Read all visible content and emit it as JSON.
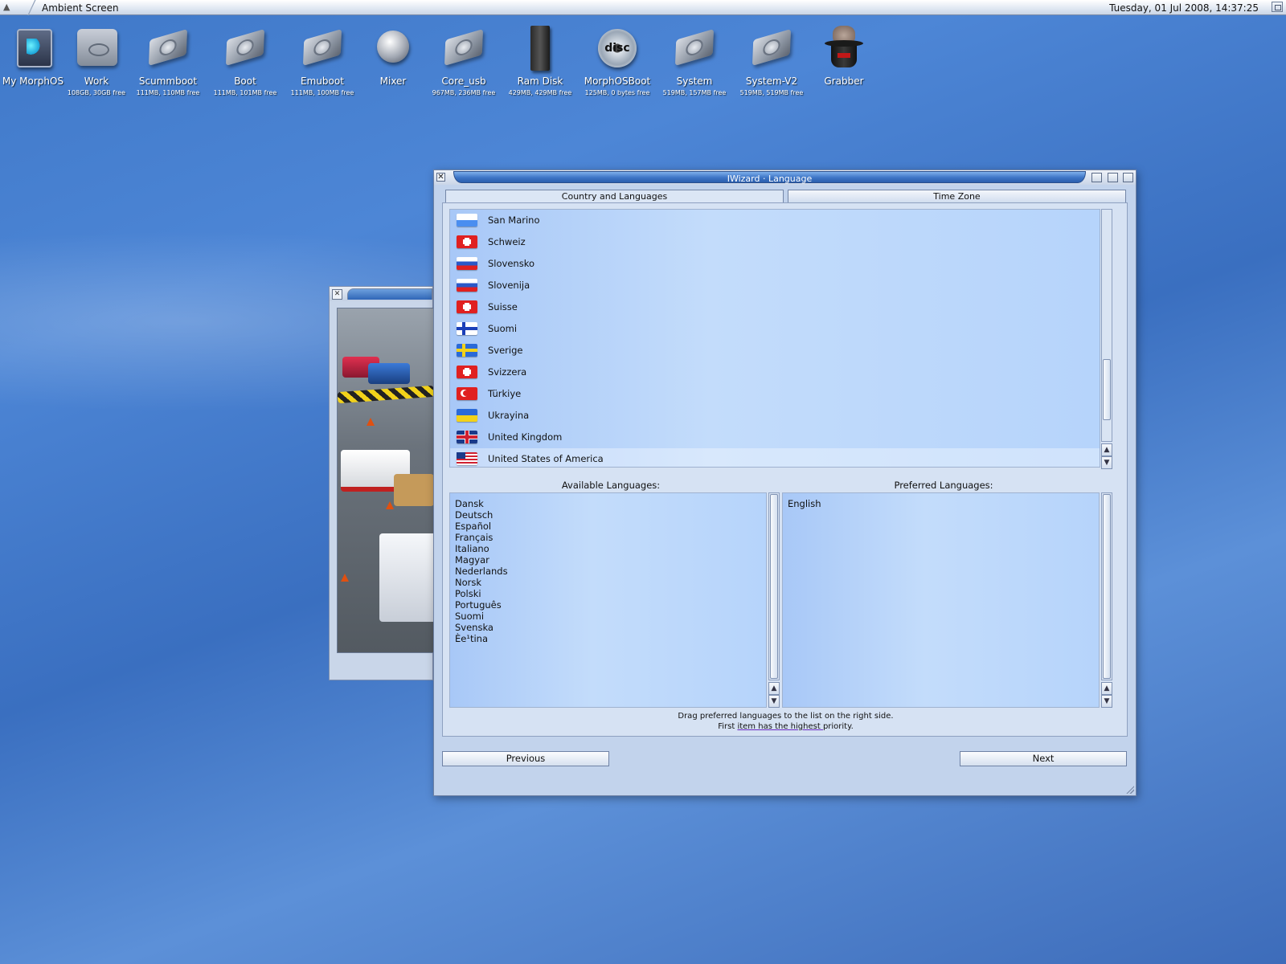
{
  "menubar": {
    "screen_title": "Ambient Screen",
    "clock": "Tuesday, 01 Jul 2008, 14:37:25"
  },
  "desktop_icons": [
    {
      "name": "My MorphOS",
      "info": "",
      "icon": "morphos-icon"
    },
    {
      "name": "Work",
      "info": "108GB, 30GB free",
      "icon": "harddisk-icon"
    },
    {
      "name": "Scummboot",
      "info": "111MB, 110MB free",
      "icon": "drive-icon"
    },
    {
      "name": "Boot",
      "info": "111MB, 101MB free",
      "icon": "drive-icon"
    },
    {
      "name": "Emuboot",
      "info": "111MB, 100MB free",
      "icon": "drive-icon"
    },
    {
      "name": "Mixer",
      "info": "",
      "icon": "mixer-icon"
    },
    {
      "name": "Core_usb",
      "info": "967MB, 236MB free",
      "icon": "drive-icon"
    },
    {
      "name": "Ram Disk",
      "info": "429MB, 429MB free",
      "icon": "ram-disk-icon"
    },
    {
      "name": "MorphOSBoot",
      "info": "125MB, 0 bytes free",
      "icon": "disc-icon"
    },
    {
      "name": "System",
      "info": "519MB, 157MB free",
      "icon": "drive-icon"
    },
    {
      "name": "System-V2",
      "info": "519MB, 519MB free",
      "icon": "drive-icon"
    },
    {
      "name": "Grabber",
      "info": "",
      "icon": "grabber-hat-icon"
    }
  ],
  "window": {
    "title": "IWizard · Language",
    "tabs": [
      {
        "label": "Country and Languages",
        "active": true
      },
      {
        "label": "Time Zone",
        "active": false
      }
    ],
    "countries": [
      {
        "label": "San Marino",
        "flag": "sanmarino"
      },
      {
        "label": "Schweiz",
        "flag": "swiss"
      },
      {
        "label": "Slovensko",
        "flag": "slovakia"
      },
      {
        "label": "Slovenija",
        "flag": "slovenia"
      },
      {
        "label": "Suisse",
        "flag": "swiss"
      },
      {
        "label": "Suomi",
        "flag": "finland"
      },
      {
        "label": "Sverige",
        "flag": "sweden"
      },
      {
        "label": "Svizzera",
        "flag": "swiss"
      },
      {
        "label": "Türkiye",
        "flag": "turkey"
      },
      {
        "label": "Ukrayina",
        "flag": "ukraine"
      },
      {
        "label": "United Kingdom",
        "flag": "uk"
      },
      {
        "label": "United States of America",
        "flag": "usa",
        "selected": true
      }
    ],
    "available_title": "Available Languages:",
    "preferred_title": "Preferred Languages:",
    "available_languages": [
      "Dansk",
      "Deutsch",
      "Español",
      "Français",
      "Italiano",
      "Magyar",
      "Nederlands",
      "Norsk",
      "Polski",
      "Português",
      "Suomi",
      "Svenska",
      "Èe¹tina"
    ],
    "preferred_languages": [
      "English"
    ],
    "hint_line1": "Drag preferred languages to the list on the right side.",
    "hint_line2_a": "First ",
    "hint_line2_b": "item has the highest ",
    "hint_line2_c": "priority.",
    "previous_label": "Previous",
    "next_label": "Next"
  }
}
